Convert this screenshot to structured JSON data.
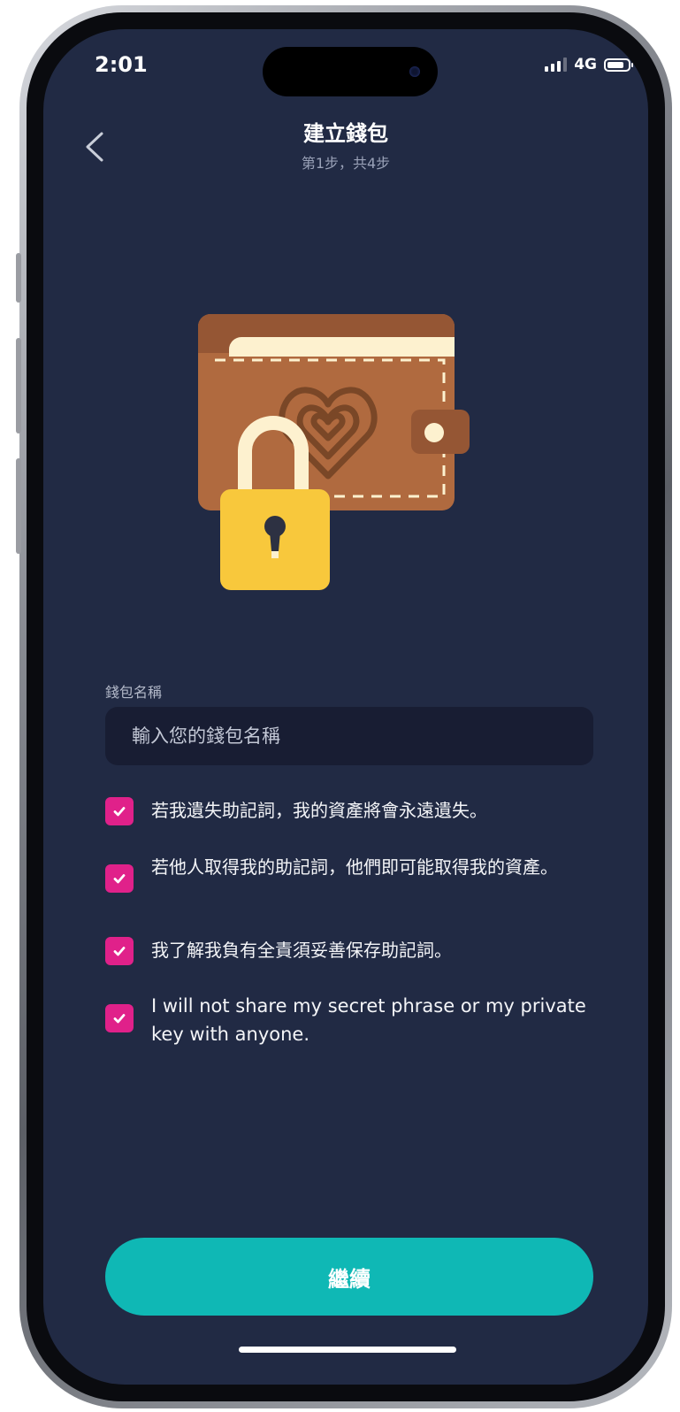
{
  "status_bar": {
    "time": "2:01",
    "network": "4G",
    "icons": [
      "signal-icon",
      "battery-icon"
    ]
  },
  "header": {
    "title": "建立錢包",
    "subtitle": "第1步，共4步",
    "back_icon": "chevron-left-icon"
  },
  "illustration": {
    "name": "wallet-with-padlock-illustration",
    "colors": {
      "wallet": "#b06a3f",
      "wallet_top": "#955634",
      "card": "#fdf1cf",
      "heart": "#7a4727",
      "lock": "#f8c83c",
      "shackle": "#fdf1cf"
    }
  },
  "form": {
    "label": "錢包名稱",
    "input": {
      "value": "",
      "placeholder": "輸入您的錢包名稱"
    }
  },
  "checklist": [
    {
      "text": "若我遺失助記詞，我的資產將會永遠遺失。",
      "checked": true
    },
    {
      "text": "若他人取得我的助記詞，他們即可能取得我的資產。",
      "checked": true
    },
    {
      "text": "我了解我負有全責須妥善保存助記詞。",
      "checked": true
    },
    {
      "text": "I will not share my secret phrase or my private key with anyone.",
      "checked": true
    }
  ],
  "continue_button": {
    "label": "繼續"
  },
  "colors": {
    "background": "#212a44",
    "input_bg": "#181d33",
    "checkbox": "#e0218a",
    "primary_button": "#0fb8b5"
  }
}
